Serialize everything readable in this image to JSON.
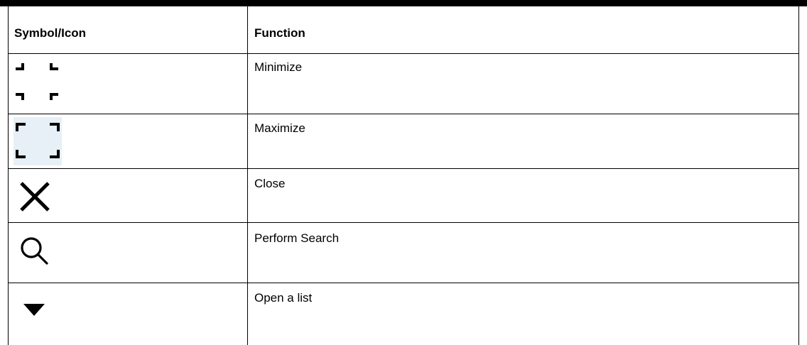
{
  "table": {
    "headers": {
      "symbol": "Symbol/Icon",
      "function": "Function"
    },
    "rows": [
      {
        "icon": "minimize-icon",
        "function": "Minimize"
      },
      {
        "icon": "maximize-icon",
        "function": "Maximize"
      },
      {
        "icon": "close-icon",
        "function": "Close"
      },
      {
        "icon": "search-icon",
        "function": "Perform Search"
      },
      {
        "icon": "dropdown-arrow-icon",
        "function": "Open a list"
      }
    ]
  },
  "colors": {
    "rule": "#000000",
    "maximize_icon_background": "#e6f0f6"
  }
}
